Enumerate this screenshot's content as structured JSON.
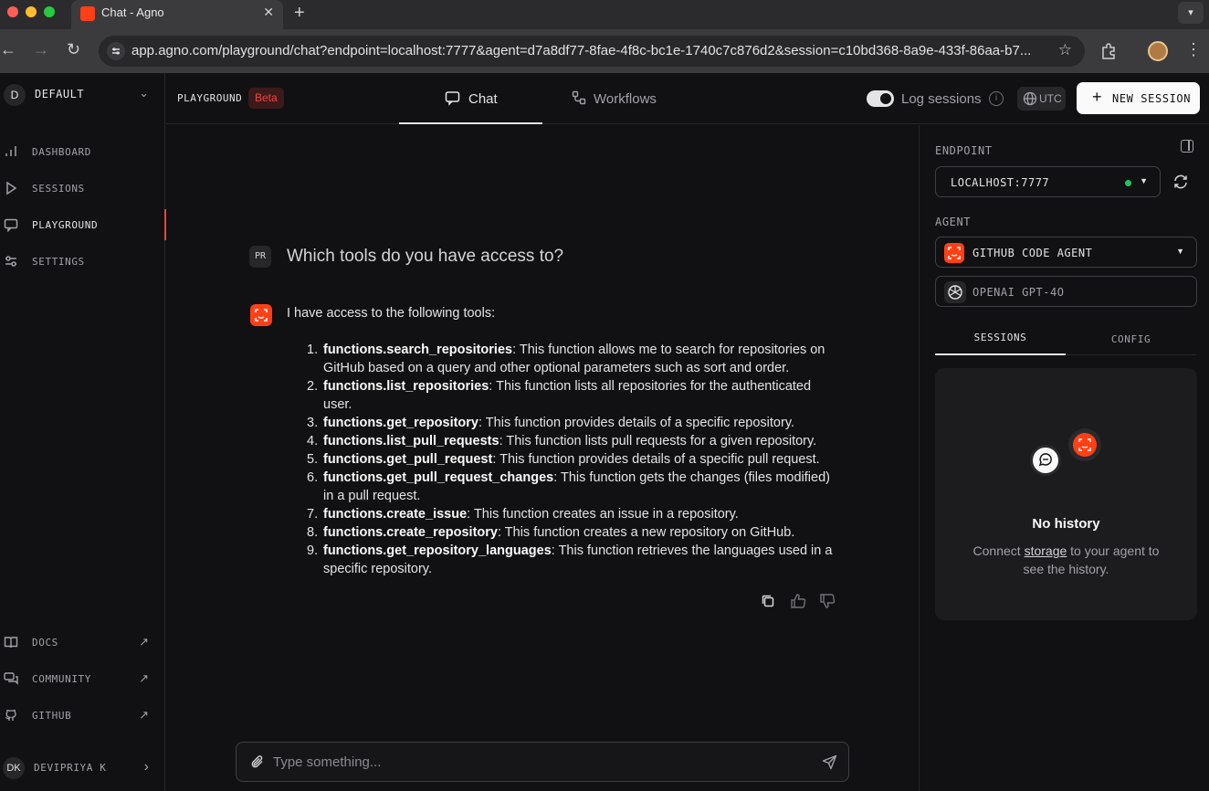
{
  "browser": {
    "tab_title": "Chat - Agno",
    "url": "app.agno.com/playground/chat?endpoint=localhost:7777&agent=d7a8df77-8fae-4f8c-bc1e-1740c7c876d2&session=c10bd368-8a9e-433f-86aa-b7..."
  },
  "sidebar": {
    "workspace_initial": "D",
    "workspace_name": "DEFAULT",
    "nav": [
      {
        "label": "DASHBOARD",
        "icon": "bar-chart-icon"
      },
      {
        "label": "SESSIONS",
        "icon": "play-icon"
      },
      {
        "label": "PLAYGROUND",
        "icon": "chat-icon"
      },
      {
        "label": "SETTINGS",
        "icon": "sliders-icon"
      }
    ],
    "links": [
      {
        "label": "DOCS",
        "icon": "book-icon"
      },
      {
        "label": "COMMUNITY",
        "icon": "chat-bubbles-icon"
      },
      {
        "label": "GITHUB",
        "icon": "github-icon"
      }
    ],
    "user_initials": "DK",
    "user_name": "DEVIPRIYA K"
  },
  "topbar": {
    "title": "PLAYGROUND",
    "badge": "Beta",
    "tabs": [
      {
        "label": "Chat",
        "active": true
      },
      {
        "label": "Workflows",
        "active": false
      }
    ],
    "log_sessions_label": "Log sessions",
    "log_sessions_on": true,
    "timezone": "UTC",
    "new_session_label": "NEW SESSION"
  },
  "chat": {
    "user_initials": "PR",
    "user_message": "Which tools do you have access to?",
    "agent_intro": "I have access to the following tools:",
    "tools": [
      {
        "num": "1.",
        "name": "functions.search_repositories",
        "desc": ": This function allows me to search for repositories on GitHub based on a query and other optional parameters such as sort and order."
      },
      {
        "num": "2.",
        "name": "functions.list_repositories",
        "desc": ": This function lists all repositories for the authenticated user."
      },
      {
        "num": "3.",
        "name": "functions.get_repository",
        "desc": ": This function provides details of a specific repository."
      },
      {
        "num": "4.",
        "name": "functions.list_pull_requests",
        "desc": ": This function lists pull requests for a given repository."
      },
      {
        "num": "5.",
        "name": "functions.get_pull_request",
        "desc": ": This function provides details of a specific pull request."
      },
      {
        "num": "6.",
        "name": "functions.get_pull_request_changes",
        "desc": ": This function gets the changes (files modified) in a pull request."
      },
      {
        "num": "7.",
        "name": "functions.create_issue",
        "desc": ": This function creates an issue in a repository."
      },
      {
        "num": "8.",
        "name": "functions.create_repository",
        "desc": ": This function creates a new repository on GitHub."
      },
      {
        "num": "9.",
        "name": "functions.get_repository_languages",
        "desc": ": This function retrieves the languages used in a specific repository."
      }
    ],
    "input_placeholder": "Type something..."
  },
  "panel": {
    "endpoint_label": "ENDPOINT",
    "endpoint_value": "LOCALHOST:7777",
    "endpoint_status_color": "#22c55e",
    "agent_label": "AGENT",
    "agent_value": "GITHUB CODE AGENT",
    "model_value": "OPENAI GPT-4O",
    "tabs": [
      {
        "label": "SESSIONS",
        "active": true
      },
      {
        "label": "CONFIG",
        "active": false
      }
    ],
    "no_history_title": "No history",
    "no_history_pre": "Connect ",
    "no_history_link": "storage",
    "no_history_post": " to your agent to see the history."
  },
  "colors": {
    "accent": "#ff4017",
    "badge_text": "#ef4444"
  }
}
